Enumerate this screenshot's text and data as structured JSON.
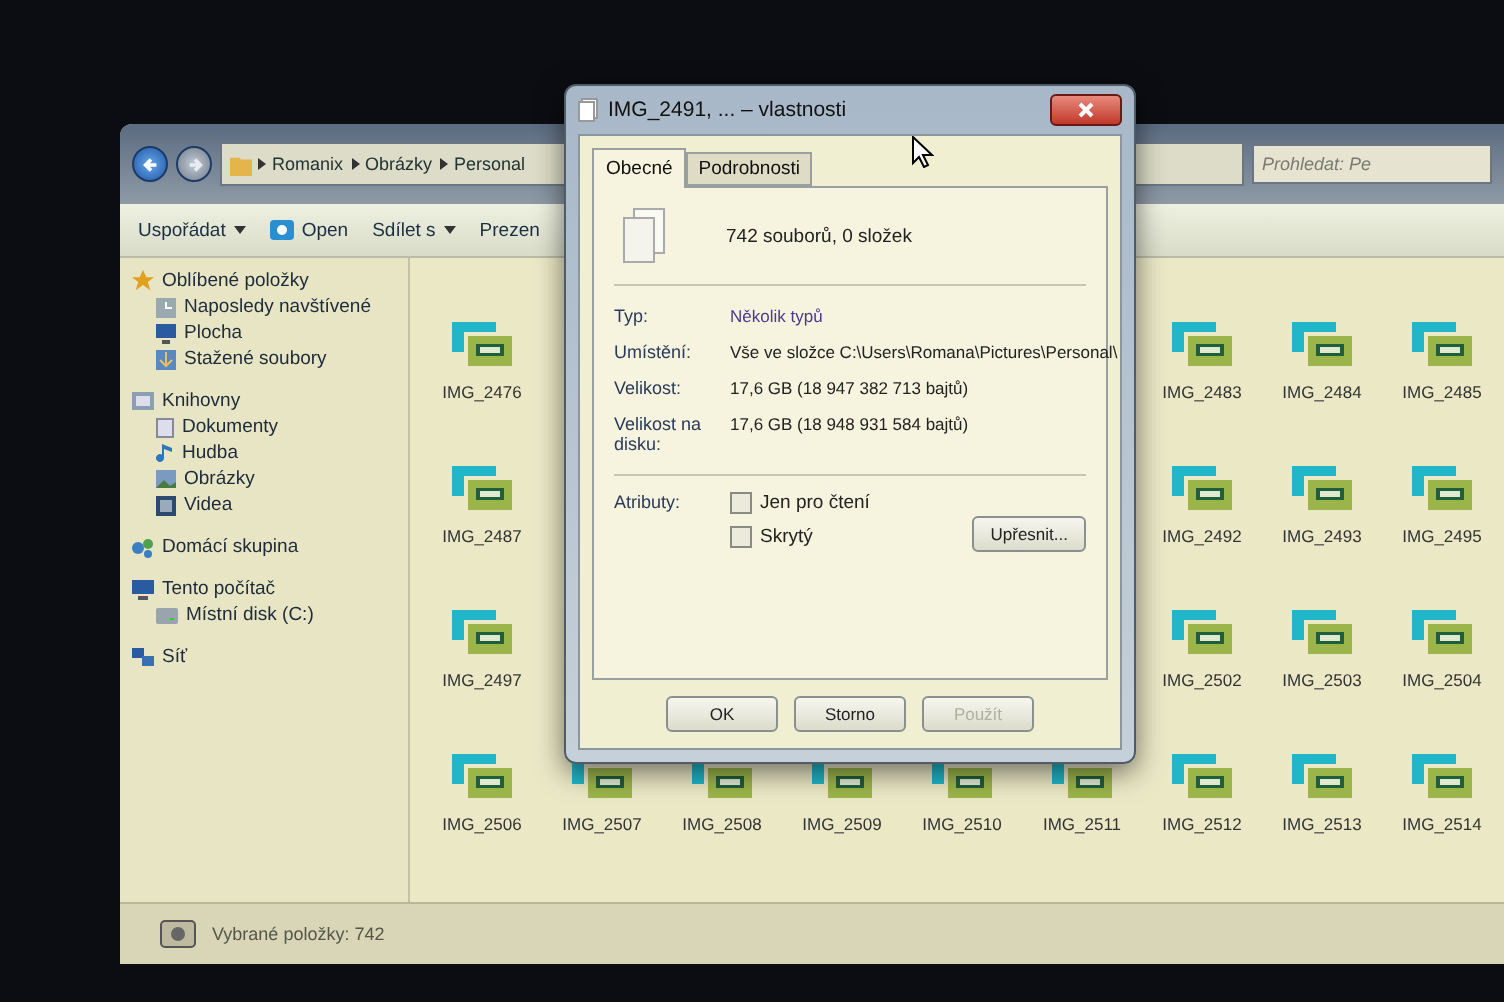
{
  "explorer": {
    "breadcrumbs": [
      "Romanix",
      "Obrázky",
      "Personal"
    ],
    "search": {
      "placeholder": "Prohledat: Pe"
    },
    "toolbar": [
      {
        "label": "Uspořádat",
        "kind": "menu"
      },
      {
        "label": "Open",
        "kind": "open"
      },
      {
        "label": "Sdílet s",
        "kind": "menu"
      },
      {
        "label": "Prezen",
        "kind": "plain"
      }
    ],
    "sidebar": [
      {
        "label": "Oblíbené položky",
        "kind": "star",
        "children": [
          {
            "label": "Naposledy navštívené",
            "kind": "recent"
          },
          {
            "label": "Plocha",
            "kind": "desktop"
          },
          {
            "label": "Stažené soubory",
            "kind": "download"
          }
        ]
      },
      {
        "label": "Knihovny",
        "kind": "library",
        "children": [
          {
            "label": "Dokumenty",
            "kind": "document"
          },
          {
            "label": "Hudba",
            "kind": "music"
          },
          {
            "label": "Obrázky",
            "kind": "picture"
          },
          {
            "label": "Videa",
            "kind": "video"
          }
        ]
      },
      {
        "label": "Domácí skupina",
        "kind": "homegroup"
      },
      {
        "label": "Tento počítač",
        "kind": "computer",
        "children": [
          {
            "label": "Místní disk (C:)",
            "kind": "disk"
          }
        ]
      },
      {
        "label": "Síť",
        "kind": "network"
      }
    ],
    "file_rows": [
      {
        "kind": "split",
        "items": [
          "IMG_2476",
          "IMG_2483",
          "IMG_2484",
          "IMG_2485"
        ]
      },
      {
        "kind": "split",
        "items": [
          "IMG_2487",
          "IMG_2492",
          "IMG_2493",
          "IMG_2495"
        ]
      },
      {
        "kind": "split",
        "items": [
          "IMG_2497",
          "IMG_2502",
          "IMG_2503",
          "IMG_2504"
        ]
      },
      {
        "kind": "full",
        "items": [
          "IMG_2506",
          "IMG_2507",
          "IMG_2508",
          "IMG_2509",
          "IMG_2510",
          "IMG_2511",
          "IMG_2512",
          "IMG_2513",
          "IMG_2514"
        ]
      }
    ],
    "status_bar": "Vybrané položky: 742"
  },
  "dialog": {
    "title": "IMG_2491, ... – vlastnosti",
    "tabs": [
      {
        "label": "Obecné",
        "selected": true
      },
      {
        "label": "Podrobnosti",
        "selected": false
      }
    ],
    "summary": "742 souborů, 0 složek",
    "properties": [
      {
        "label": "Typ:",
        "value": "Několik typů"
      },
      {
        "label": "Umístění:",
        "value": "Vše ve složce C:\\Users\\Romana\\Pictures\\Personal\\"
      },
      {
        "label": "Velikost:",
        "value": "17,6 GB (18 947 382 713 bajtů)"
      },
      {
        "label": "Velikost na disku:",
        "value": "17,6 GB (18 948 931 584 bajtů)"
      }
    ],
    "attributes_label": "Atributy:",
    "attributes": [
      {
        "label": "Jen pro čtení",
        "checked": false
      },
      {
        "label": "Skrytý",
        "checked": false
      }
    ],
    "advanced_button": "Upřesnit...",
    "buttons": [
      {
        "label": "OK",
        "disabled": false
      },
      {
        "label": "Storno",
        "disabled": false
      },
      {
        "label": "Použít",
        "disabled": true
      }
    ]
  }
}
